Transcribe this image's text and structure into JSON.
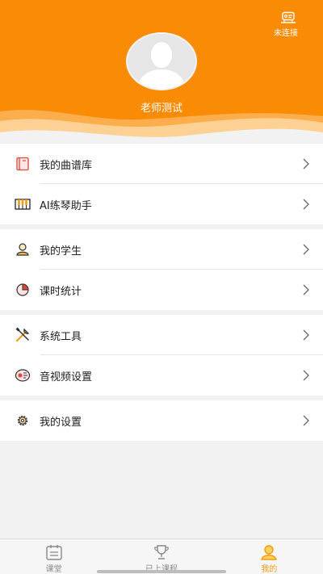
{
  "header": {
    "connection_status": "未连接",
    "username": "老师测试",
    "background_color": "#fa8c05"
  },
  "menu_groups": [
    {
      "items": [
        {
          "label": "我的曲谱库",
          "icon": "music-library-icon"
        },
        {
          "label": "AI练琴助手",
          "icon": "piano-keys-icon"
        }
      ]
    },
    {
      "items": [
        {
          "label": "我的学生",
          "icon": "student-icon"
        },
        {
          "label": "课时统计",
          "icon": "pie-chart-icon"
        }
      ]
    },
    {
      "items": [
        {
          "label": "系统工具",
          "icon": "tools-icon"
        },
        {
          "label": "音视频设置",
          "icon": "media-settings-icon"
        }
      ]
    },
    {
      "items": [
        {
          "label": "我的设置",
          "icon": "gear-icon"
        }
      ]
    }
  ],
  "tabbar": {
    "tabs": [
      {
        "label": "课堂",
        "icon": "calendar-icon",
        "active": false
      },
      {
        "label": "已上课程",
        "icon": "trophy-icon",
        "active": false
      },
      {
        "label": "我的",
        "icon": "profile-icon",
        "active": true
      }
    ],
    "active_color": "#f39b13"
  }
}
